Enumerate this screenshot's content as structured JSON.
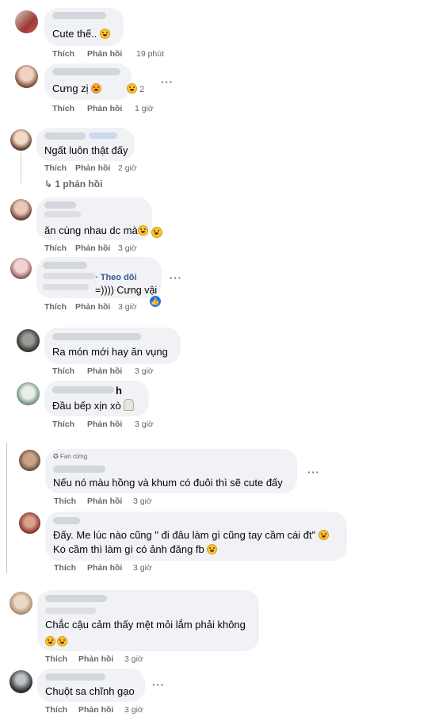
{
  "actions": {
    "like": "Thích",
    "reply": "Phản hồi"
  },
  "comments": [
    {
      "id": 1,
      "text": "Cute thế..",
      "time": "19 phút"
    },
    {
      "id": 2,
      "text": "Cưng zị",
      "reaction_count": "2",
      "time": "1 giờ"
    },
    {
      "id": 3,
      "text": "Ngất luôn thật đấy",
      "time": "2 giờ",
      "replies_link": "1 phản hồi"
    },
    {
      "id": 4,
      "text": "ăn cùng nhau dc mà",
      "time": "3 giờ"
    },
    {
      "id": 5,
      "follow": "Theo dõi",
      "text": "=)))) Cưng vậi",
      "time": "3 giờ"
    },
    {
      "id": 6,
      "text": "Ra món mới hay ăn vụng",
      "time": "3 giờ"
    },
    {
      "id": 7,
      "name_suffix": "h",
      "text": "Đầu bếp xịn xò",
      "time": "3 giờ"
    },
    {
      "id": 8,
      "badge": "Fan cứng",
      "text": "Nếu nó màu hồng và khum có đuôi thì sẽ cute đấy",
      "time": "3 giờ"
    },
    {
      "id": 9,
      "text_line1": "Đấy. Me lúc nào cũng \" đi đâu làm gì cũng tay cầm cái đt\"",
      "text_line2": "Ko cầm thì làm gì có ảnh đăng fb",
      "time": "3 giờ"
    },
    {
      "id": 10,
      "text": "Chắc cậu cảm thấy mệt mỏi lắm phải không",
      "time": "3 giờ"
    },
    {
      "id": 11,
      "text": "Chuột sa chĩnh gạo",
      "time": "3 giờ"
    }
  ]
}
